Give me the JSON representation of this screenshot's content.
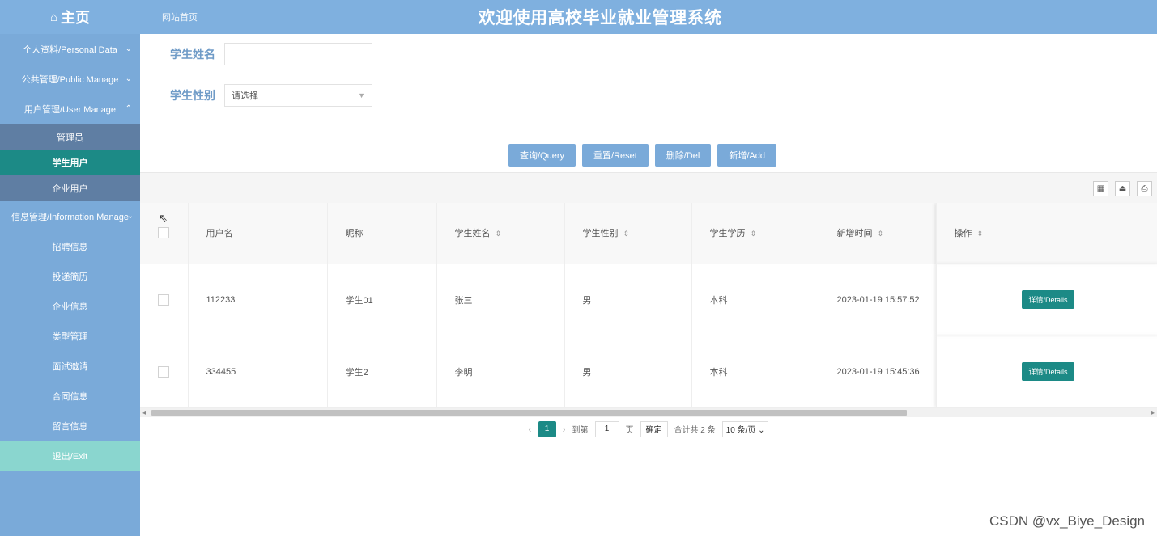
{
  "header": {
    "brand": "主页",
    "site_home": "网站首页",
    "title": "欢迎使用高校毕业就业管理系统",
    "color": "#7fb0df"
  },
  "sidebar": {
    "items": [
      {
        "label": "个人资料/Personal Data",
        "chevron": "⌄"
      },
      {
        "label": "公共管理/Public Manage",
        "chevron": "⌄"
      },
      {
        "label": "用户管理/User Manage",
        "chevron": "⌃"
      },
      {
        "label": "管理员"
      },
      {
        "label": "学生用户"
      },
      {
        "label": "企业用户"
      },
      {
        "label": "信息管理/Information Manage",
        "chevron": "⌄"
      },
      {
        "label": "招聘信息"
      },
      {
        "label": "投递简历"
      },
      {
        "label": "企业信息"
      },
      {
        "label": "类型管理"
      },
      {
        "label": "面试邀请"
      },
      {
        "label": "合同信息"
      },
      {
        "label": "留言信息"
      },
      {
        "label": "退出/Exit"
      }
    ],
    "accent": "#1c8a86"
  },
  "search": {
    "name_label": "学生姓名",
    "name_value": "",
    "gender_label": "学生性别",
    "gender_placeholder": "请选择"
  },
  "actions": {
    "query": "查询/Query",
    "reset": "重置/Reset",
    "delete": "删除/Del",
    "add": "新增/Add"
  },
  "table": {
    "columns": [
      "用户名",
      "昵称",
      "学生姓名",
      "学生性别",
      "学生学历",
      "新增时间",
      "操作"
    ],
    "rows": [
      {
        "username": "112233",
        "nickname": "学生01",
        "name": "张三",
        "gender": "男",
        "education": "本科",
        "created": "2023-01-19 15:57:52",
        "action": "详情/Details"
      },
      {
        "username": "334455",
        "nickname": "学生2",
        "name": "李明",
        "gender": "男",
        "education": "本科",
        "created": "2023-01-19 15:45:36",
        "action": "详情/Details"
      }
    ]
  },
  "pager": {
    "current_page": "1",
    "goto_label": "到第",
    "goto_value": "1",
    "page_unit": "页",
    "confirm": "确定",
    "total": "合计共 2 条",
    "page_size": "10 条/页 ⌄"
  },
  "watermark": "CSDN @vx_Biye_Design"
}
